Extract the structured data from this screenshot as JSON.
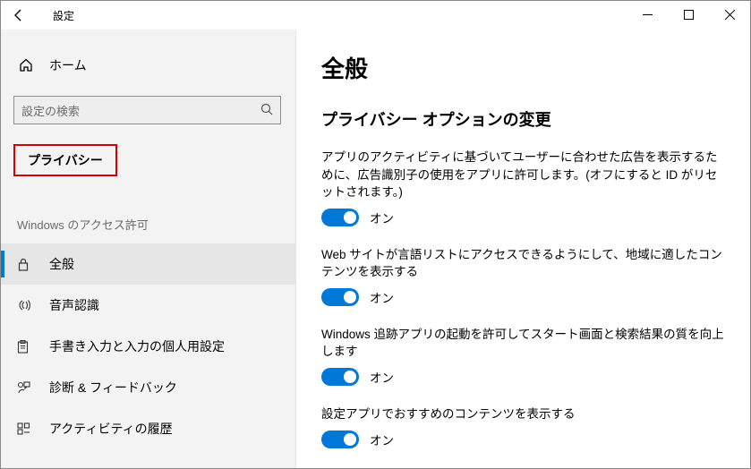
{
  "window": {
    "title": "設定"
  },
  "sidebar": {
    "home_label": "ホーム",
    "search_placeholder": "設定の検索",
    "category": "プライバシー",
    "permissions_heading": "Windows のアクセス許可",
    "items": [
      {
        "label": "全般"
      },
      {
        "label": "音声認識"
      },
      {
        "label": "手書き入力と入力の個人用設定"
      },
      {
        "label": "診断 & フィードバック"
      },
      {
        "label": "アクティビティの履歴"
      }
    ]
  },
  "content": {
    "page_title": "全般",
    "section_subtitle": "プライバシー オプションの変更",
    "settings": [
      {
        "desc": "アプリのアクティビティに基づいてユーザーに合わせた広告を表示するために、広告識別子の使用をアプリに許可します。(オフにすると ID がリセットされます。)",
        "state": "オン"
      },
      {
        "desc": "Web サイトが言語リストにアクセスできるようにして、地域に適したコンテンツを表示する",
        "state": "オン"
      },
      {
        "desc": "Windows 追跡アプリの起動を許可してスタート画面と検索結果の質を向上します",
        "state": "オン"
      },
      {
        "desc": "設定アプリでおすすめのコンテンツを表示する",
        "state": "オン"
      }
    ]
  }
}
